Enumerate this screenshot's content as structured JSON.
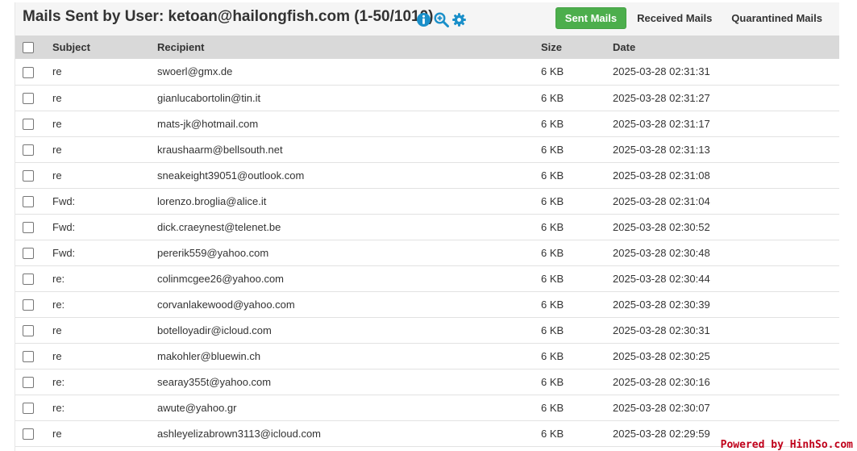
{
  "header": {
    "title": "Mails Sent by User: ketoan@hailongfish.com (1-50/1010)",
    "icons": [
      "info-icon",
      "zoom-in-icon",
      "gear-icon"
    ],
    "tabs": [
      {
        "label": "Sent Mails",
        "active": true
      },
      {
        "label": "Received Mails",
        "active": false
      },
      {
        "label": "Quarantined Mails",
        "active": false
      }
    ],
    "accent_color": "#4cae4c",
    "icon_color": "#1a8fc9"
  },
  "table": {
    "columns": [
      "Subject",
      "Recipient",
      "Size",
      "Date"
    ],
    "rows": [
      {
        "subject": "re",
        "recipient": "swoerl@gmx.de",
        "size": "6 KB",
        "date": "2025-03-28 02:31:31"
      },
      {
        "subject": "re",
        "recipient": "gianlucabortolin@tin.it",
        "size": "6 KB",
        "date": "2025-03-28 02:31:27"
      },
      {
        "subject": "re",
        "recipient": "mats-jk@hotmail.com",
        "size": "6 KB",
        "date": "2025-03-28 02:31:17"
      },
      {
        "subject": "re",
        "recipient": "kraushaarm@bellsouth.net",
        "size": "6 KB",
        "date": "2025-03-28 02:31:13"
      },
      {
        "subject": "re",
        "recipient": "sneakeight39051@outlook.com",
        "size": "6 KB",
        "date": "2025-03-28 02:31:08"
      },
      {
        "subject": "Fwd:",
        "recipient": "lorenzo.broglia@alice.it",
        "size": "6 KB",
        "date": "2025-03-28 02:31:04"
      },
      {
        "subject": "Fwd:",
        "recipient": "dick.craeynest@telenet.be",
        "size": "6 KB",
        "date": "2025-03-28 02:30:52"
      },
      {
        "subject": "Fwd:",
        "recipient": "pererik559@yahoo.com",
        "size": "6 KB",
        "date": "2025-03-28 02:30:48"
      },
      {
        "subject": "re:",
        "recipient": "colinmcgee26@yahoo.com",
        "size": "6 KB",
        "date": "2025-03-28 02:30:44"
      },
      {
        "subject": "re:",
        "recipient": "corvanlakewood@yahoo.com",
        "size": "6 KB",
        "date": "2025-03-28 02:30:39"
      },
      {
        "subject": "re",
        "recipient": "botelloyadir@icloud.com",
        "size": "6 KB",
        "date": "2025-03-28 02:30:31"
      },
      {
        "subject": "re",
        "recipient": "makohler@bluewin.ch",
        "size": "6 KB",
        "date": "2025-03-28 02:30:25"
      },
      {
        "subject": "re:",
        "recipient": "searay355t@yahoo.com",
        "size": "6 KB",
        "date": "2025-03-28 02:30:16"
      },
      {
        "subject": "re:",
        "recipient": "awute@yahoo.gr",
        "size": "6 KB",
        "date": "2025-03-28 02:30:07"
      },
      {
        "subject": "re",
        "recipient": "ashleyelizabrown3113@icloud.com",
        "size": "6 KB",
        "date": "2025-03-28 02:29:59"
      }
    ]
  },
  "watermark": "Powered by HinhSo.com"
}
